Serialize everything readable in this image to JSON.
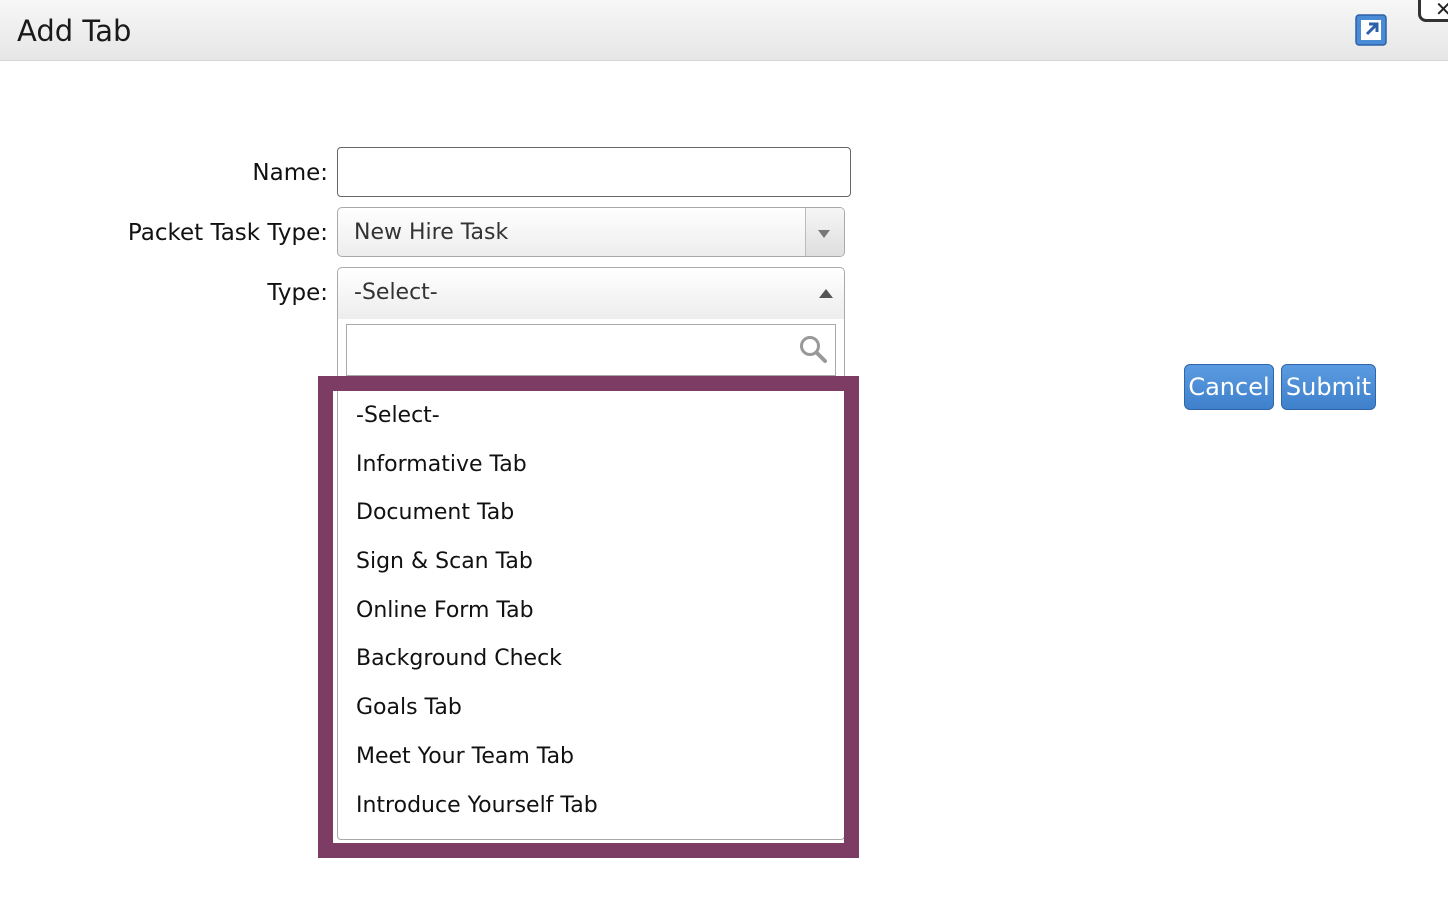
{
  "dialog": {
    "title": "Add Tab"
  },
  "form": {
    "name_label": "Name:",
    "name_value": "",
    "packet_task_type_label": "Packet Task Type:",
    "packet_task_type_value": "New Hire Task",
    "type_label": "Type:",
    "type_value": "-Select-"
  },
  "type_dropdown": {
    "search_value": "",
    "options": [
      "-Select-",
      "Informative Tab",
      "Document Tab",
      "Sign & Scan Tab",
      "Online Form Tab",
      "Background Check",
      "Goals Tab",
      "Meet Your Team Tab",
      "Introduce Yourself Tab"
    ]
  },
  "buttons": {
    "cancel": "Cancel",
    "submit": "Submit"
  },
  "icons": {
    "expand": "expand-icon",
    "close": "close-icon",
    "search": "search-icon",
    "dropdown_arrow": "chevron-down-icon",
    "dropdown_open_arrow": "chevron-up-icon"
  },
  "colors": {
    "highlight_border": "#7d3c64",
    "button_blue": "#4a8bd6"
  }
}
